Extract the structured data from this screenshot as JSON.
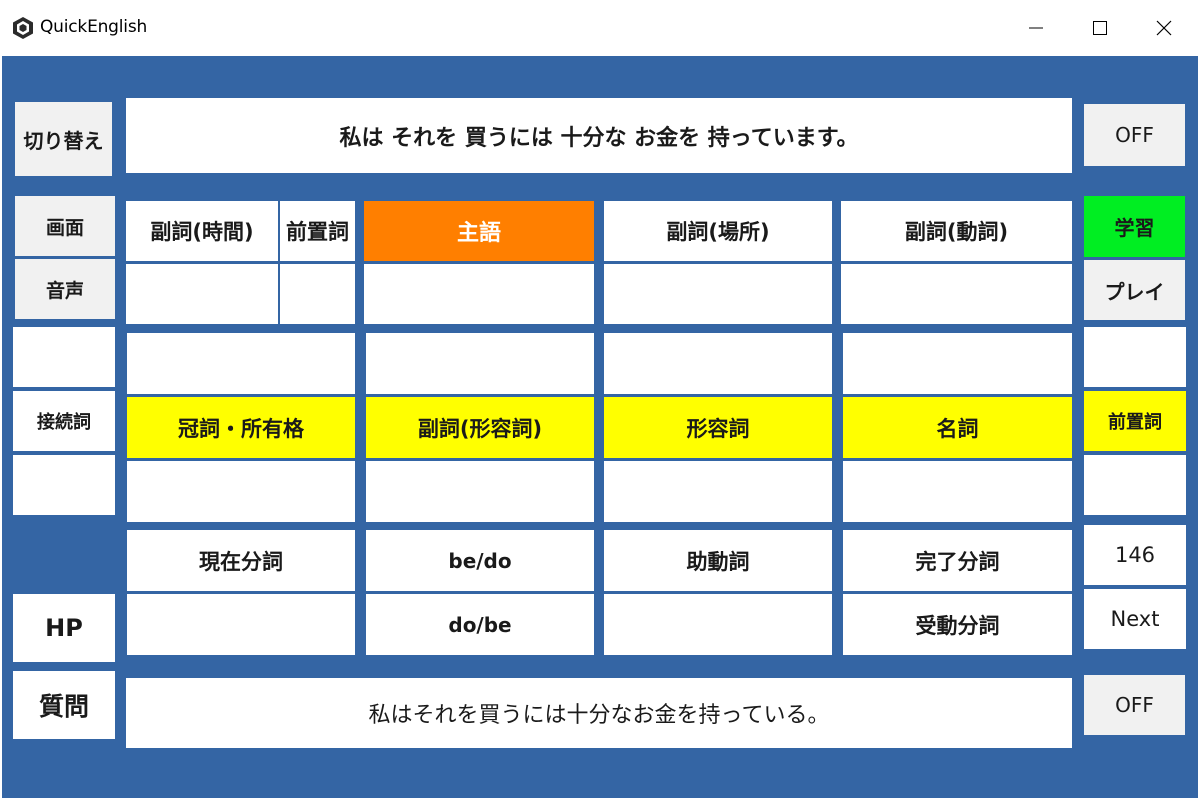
{
  "window": {
    "title": "QuickEnglish",
    "controls": [
      "minimize-icon",
      "maximize-icon",
      "close-icon"
    ]
  },
  "left": {
    "switch": "切り替え",
    "screen": "画面",
    "voice": "音声",
    "conjunction": "接続詞",
    "hp": "HP",
    "question": "質問"
  },
  "top": {
    "sentence": "私は それを 買うには 十分な お金を 持っています。"
  },
  "bottom": {
    "translation": "私はそれを買うには十分なお金を持っている。"
  },
  "right": {
    "off_top": "OFF",
    "study": "学習",
    "play": "プレイ",
    "preposition": "前置詞",
    "count": "146",
    "next": "Next",
    "off_bottom": "OFF"
  },
  "grid": {
    "row1": {
      "adverb_time": "副詞(時間)",
      "preposition": "前置詞",
      "subject": "主語",
      "adverb_place": "副詞(場所)",
      "adverb_verb": "副詞(動詞)"
    },
    "row2": {
      "article_possessive": "冠詞・所有格",
      "adverb_adjective": "副詞(形容詞)",
      "adjective": "形容詞",
      "noun": "名詞"
    },
    "row3": {
      "present_participle": "現在分詞",
      "be_do": "be/do",
      "do_be": "do/be",
      "auxiliary": "助動詞",
      "perfect_participle": "完了分詞",
      "passive_participle": "受動分詞"
    }
  },
  "colors": {
    "background": "#3465a4",
    "highlight_orange": "#ff7f00",
    "highlight_yellow": "#ffff00",
    "highlight_green": "#00ee22"
  }
}
